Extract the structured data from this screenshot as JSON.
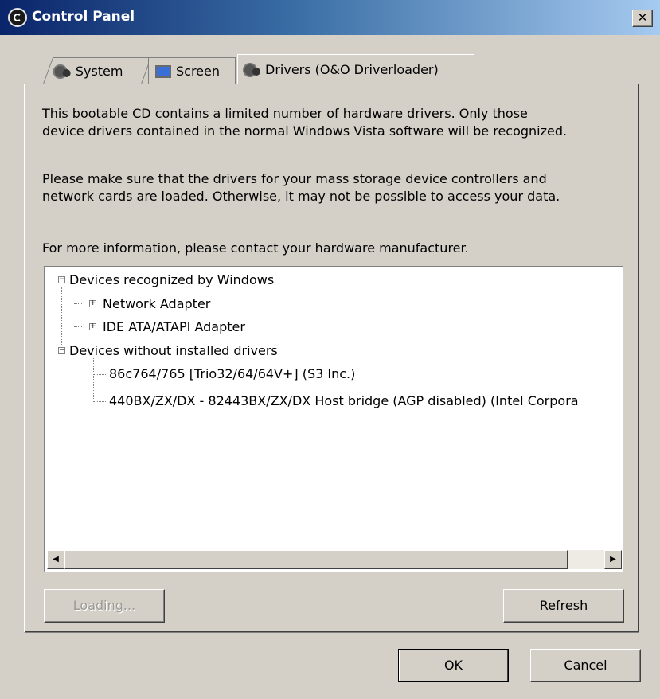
{
  "window": {
    "title": "Control Panel",
    "close_label": "✕"
  },
  "tabs": [
    {
      "label": "System",
      "icon": "gear-icon"
    },
    {
      "label": "Screen",
      "icon": "monitor-icon"
    },
    {
      "label": "Drivers (O&O Driverloader)",
      "icon": "gears-icon",
      "active": true
    }
  ],
  "info": {
    "p1_line1": "This bootable CD contains a limited number of hardware drivers. Only those",
    "p1_line2": "device drivers contained in the normal Windows Vista software will be recognized.",
    "p2_line1": "Please make sure that the drivers for your mass storage device controllers and",
    "p2_line2": "network cards are loaded. Otherwise, it may not be possible to access your data.",
    "p3": "For more information, please contact your hardware manufacturer."
  },
  "tree": {
    "recognized": {
      "label": "Devices recognized by Windows",
      "expanded": true
    },
    "network": {
      "label": "Network Adapter",
      "expanded": false
    },
    "ide": {
      "label": "IDE ATA/ATAPI Adapter",
      "expanded": false
    },
    "without": {
      "label": "Devices without installed drivers",
      "expanded": true
    },
    "dev1": {
      "label": "86c764/765 [Trio32/64/64V+] (S3 Inc.)"
    },
    "dev2": {
      "label": "440BX/ZX/DX - 82443BX/ZX/DX Host bridge (AGP disabled) (Intel Corpora"
    }
  },
  "buttons": {
    "loading": "Loading...",
    "refresh": "Refresh",
    "ok": "OK",
    "cancel": "Cancel"
  }
}
